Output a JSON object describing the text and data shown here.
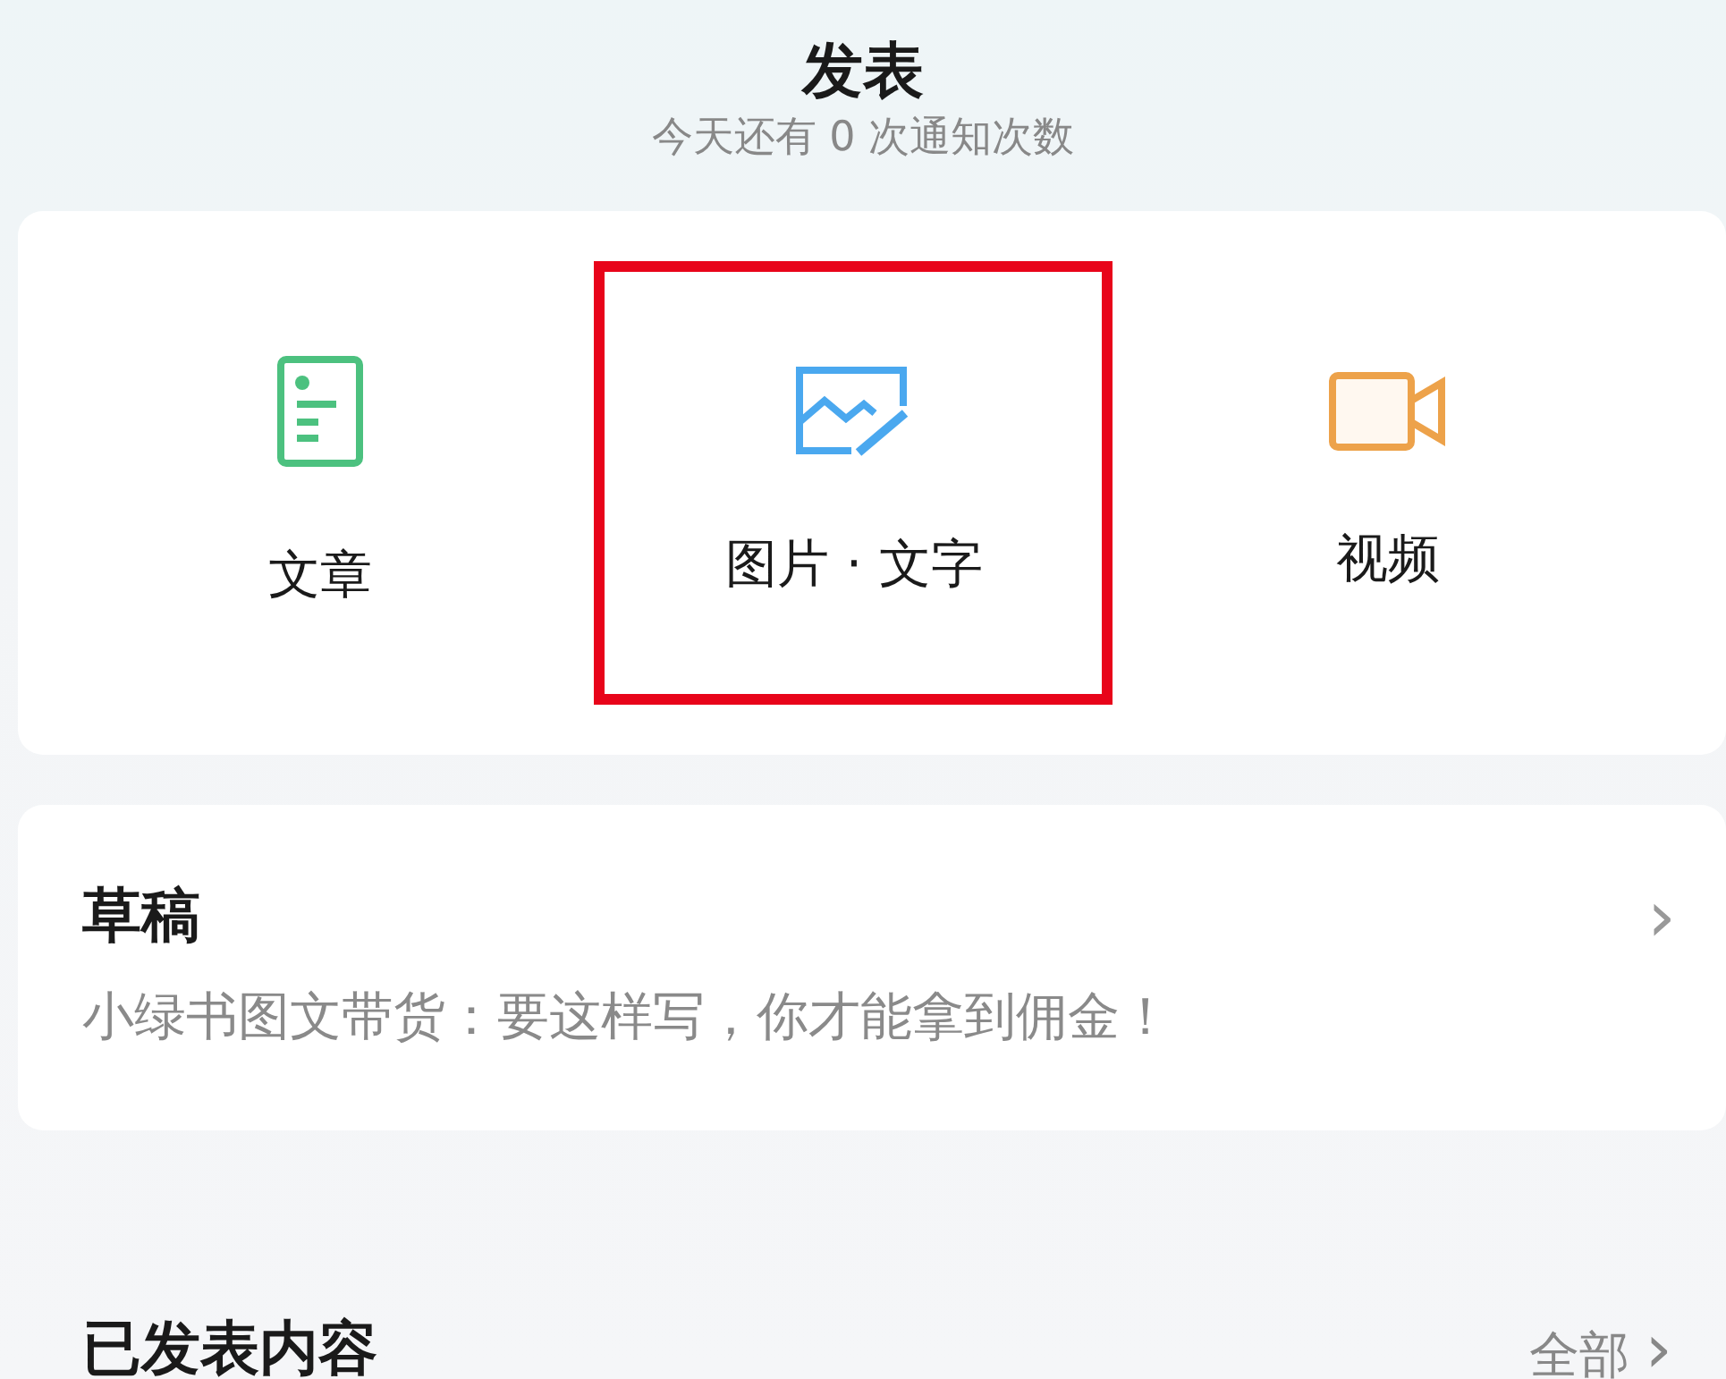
{
  "header": {
    "title": "发表",
    "subtitle": "今天还有 0 次通知次数"
  },
  "options": [
    {
      "kind": "article",
      "label": "文章",
      "highlighted": false
    },
    {
      "kind": "image",
      "label": "图片 · 文字",
      "highlighted": true
    },
    {
      "kind": "video",
      "label": "视频",
      "highlighted": false
    }
  ],
  "draft": {
    "title": "草稿",
    "text": "小绿书图文带货：要这样写，你才能拿到佣金！",
    "chevron": "›"
  },
  "published": {
    "title": "已发表内容",
    "link": "全部",
    "chevron": "›"
  }
}
